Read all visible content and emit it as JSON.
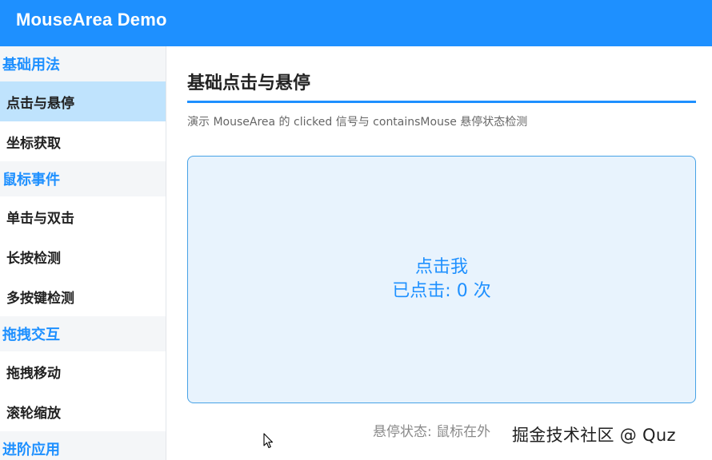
{
  "window": {
    "title": "MouseArea Demo"
  },
  "sidebar": {
    "groups": [
      {
        "label": "基础用法",
        "items": [
          {
            "label": "点击与悬停",
            "active": true
          },
          {
            "label": "坐标获取"
          }
        ]
      },
      {
        "label": "鼠标事件",
        "items": [
          {
            "label": "单击与双击"
          },
          {
            "label": "长按检测"
          },
          {
            "label": "多按键检测"
          }
        ]
      },
      {
        "label": "拖拽交互",
        "items": [
          {
            "label": "拖拽移动"
          },
          {
            "label": "滚轮缩放"
          }
        ]
      },
      {
        "label": "进阶应用",
        "items": []
      }
    ]
  },
  "main": {
    "title": "基础点击与悬停",
    "description": "演示 MouseArea 的 clicked 信号与 containsMouse 悬停状态检测",
    "click_area": {
      "label": "点击我",
      "count_text": "已点击: 0 次"
    },
    "hover_status": "悬停状态: 鼠标在外"
  },
  "watermark": "掘金技术社区 @ Quz",
  "colors": {
    "accent": "#1e90ff",
    "active_item_bg": "#bfe3fd",
    "group_bg": "#f4f6f8",
    "area_bg": "#e8f3fd"
  }
}
